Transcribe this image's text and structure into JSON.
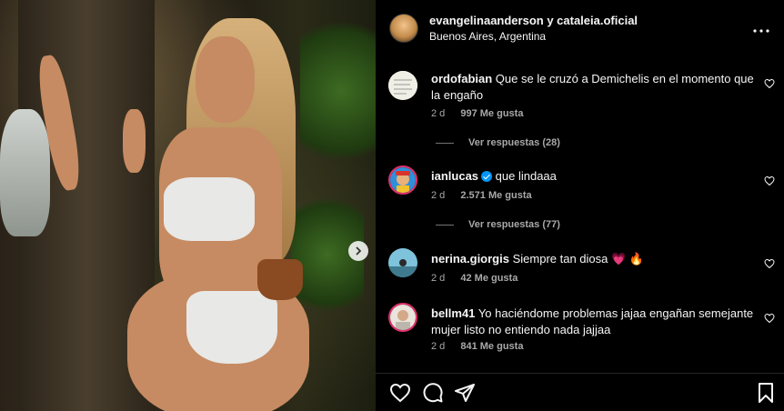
{
  "post": {
    "author": "evangelinaanderson y cataleia.oficial",
    "location": "Buenos Aires, Argentina",
    "more_icon": "ellipsis-icon",
    "image_alt": "photo",
    "next_icon": "chevron-right-icon"
  },
  "comments": [
    {
      "user": "ordofabian",
      "text": "Que se le cruzó a Demichelis en el momento que la engaño",
      "time": "2 d",
      "likes": "997 Me gusta",
      "verified": false,
      "replies": "Ver respuestas (28)"
    },
    {
      "user": "ianlucas",
      "text": "que lindaaa",
      "time": "2 d",
      "likes": "2.571 Me gusta",
      "verified": true,
      "replies": "Ver respuestas (77)"
    },
    {
      "user": "nerina.giorgis",
      "text": "Siempre tan diosa 💗 🔥",
      "time": "2 d",
      "likes": "42 Me gusta",
      "verified": false,
      "replies": null
    },
    {
      "user": "bellm41",
      "text": "Yo haciéndome problemas jajaa engañan semejante mujer listo no entiendo nada jajjaa",
      "time": "2 d",
      "likes": "841 Me gusta",
      "verified": false,
      "replies": null
    }
  ],
  "actions": {
    "like_icon": "heart-icon",
    "comment_icon": "comment-icon",
    "share_icon": "share-icon",
    "save_icon": "bookmark-icon"
  },
  "colors": {
    "background": "#000000",
    "text": "#f5f5f5",
    "secondary": "#a8a8a8",
    "verified": "#0095f6"
  }
}
